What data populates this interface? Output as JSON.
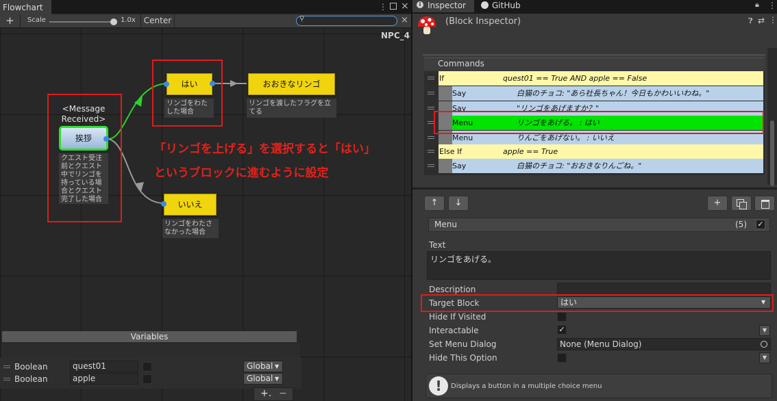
{
  "flowchart": {
    "tab": "Flowchart",
    "add": "+",
    "scale_label": "Scale",
    "scale_value": "1.0x",
    "center": "Center",
    "search_clear": "×",
    "npc_name": "NPC_4",
    "message_event": "<Message Received>",
    "blocks": {
      "greet": {
        "label": "挨拶",
        "desc": "クエスト受注前とクエスト中でリンゴを持っている場合とクエスト完了した場合"
      },
      "yes": {
        "label": "はい",
        "desc": "リンゴをわたした場合"
      },
      "big_apple": {
        "label": "おおきなリンゴ",
        "desc": "リンゴを渡したフラグを立てる"
      },
      "no": {
        "label": "いいえ",
        "desc": "リンゴをわたさなかった場合"
      }
    },
    "annotation_line1": "「リンゴを上げる」を選択すると「はい」",
    "annotation_line2": "というブロックに進むように設定",
    "variables": {
      "title": "Variables",
      "rows": [
        {
          "type": "Boolean",
          "name": "quest01",
          "scope": "Global"
        },
        {
          "type": "Boolean",
          "name": "apple",
          "scope": "Global"
        }
      ],
      "add": "+.",
      "remove": "−"
    }
  },
  "inspector": {
    "tab_inspector": "Inspector",
    "tab_github": "GitHub",
    "title": "(Block Inspector)",
    "commands_header": "Commands",
    "commands": [
      {
        "name": "If",
        "content": "quest01 == True AND apple == False",
        "color": "#fff8a8"
      },
      {
        "name": "Say",
        "content": "白猫のチョコ: \"あら社長ちゃん！今日もかわいいわね。\"",
        "color": "#b9d2ea"
      },
      {
        "name": "Say",
        "content": "\"リンゴをあげますか？\"",
        "color": "#b9d2ea"
      },
      {
        "name": "Menu",
        "content": "リンゴをあげる。 : はい",
        "color": "#00e400"
      },
      {
        "name": "Menu",
        "content": "りんごをあげない。 : いいえ",
        "color": "#b9d2ea"
      },
      {
        "name": "Else If",
        "content": "apple == True",
        "color": "#fff8a8"
      },
      {
        "name": "Say",
        "content": "白猫のチョコ: \"おおきなりんごね。\"",
        "color": "#b9d2ea"
      }
    ],
    "buttons": {
      "up": "↑",
      "down": "↓",
      "add": "+"
    },
    "command_title": "Menu",
    "command_index": "(5)",
    "text_label": "Text",
    "text_value": "リンゴをあげる。",
    "props": {
      "description": "Description",
      "target_block": "Target Block",
      "target_block_value": "はい",
      "hide_if_visited": "Hide If Visited",
      "interactable": "Interactable",
      "set_menu_dialog": "Set Menu Dialog",
      "set_menu_dialog_value": "None (Menu Dialog)",
      "hide_this_option": "Hide This Option"
    },
    "help": "Displays a button in a multiple choice menu"
  }
}
